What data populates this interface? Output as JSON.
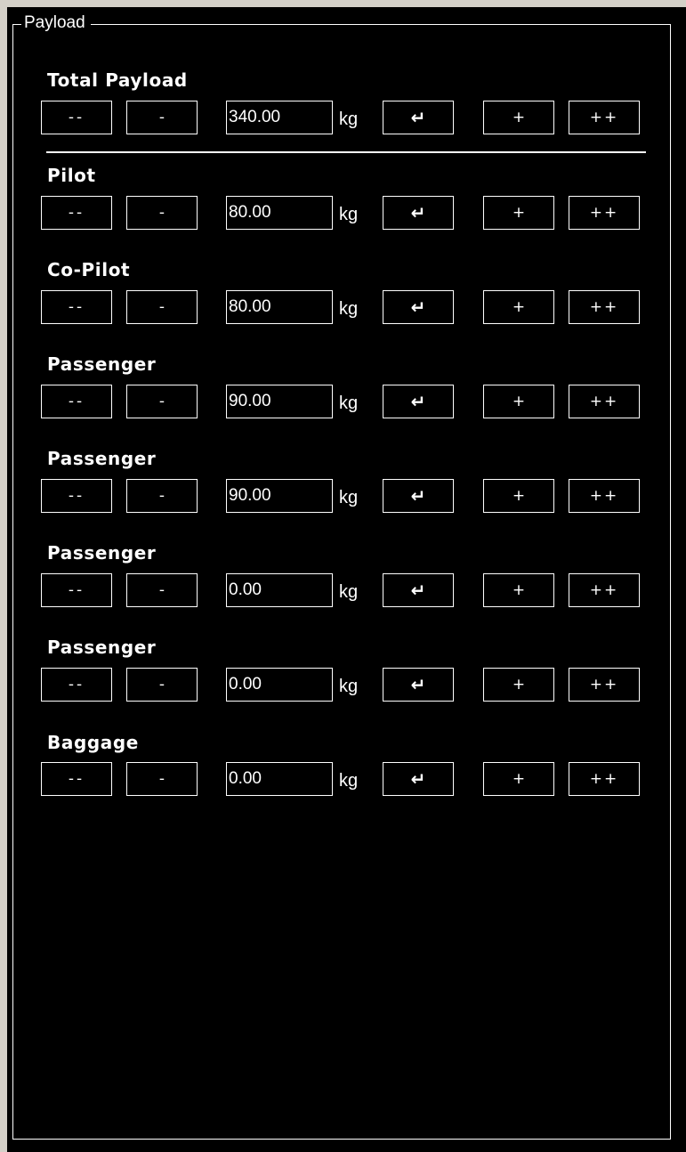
{
  "group": {
    "title": "Payload"
  },
  "controls": {
    "dec_large": "--",
    "dec_small": "-",
    "enter": "↵",
    "inc_small": "+",
    "inc_large": "++",
    "unit": "kg"
  },
  "rows": [
    {
      "label": "Total Payload",
      "value": "340.00"
    },
    {
      "label": "Pilot",
      "value": "80.00"
    },
    {
      "label": "Co-Pilot",
      "value": "80.00"
    },
    {
      "label": "Passenger",
      "value": "90.00"
    },
    {
      "label": "Passenger",
      "value": "90.00"
    },
    {
      "label": "Passenger",
      "value": "0.00"
    },
    {
      "label": "Passenger",
      "value": "0.00"
    },
    {
      "label": "Baggage",
      "value": "0.00"
    }
  ]
}
